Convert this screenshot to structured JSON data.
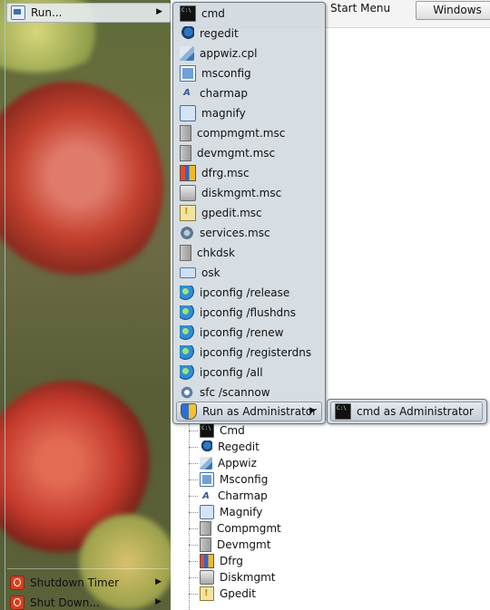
{
  "background_window": {
    "label": "Start Menu",
    "button_label": "Windows",
    "tree": [
      {
        "label": "Cmd",
        "icon": "cmd-icon"
      },
      {
        "label": "Regedit",
        "icon": "regedit-icon"
      },
      {
        "label": "Appwiz",
        "icon": "appwiz-icon"
      },
      {
        "label": "Msconfig",
        "icon": "msconfig-icon"
      },
      {
        "label": "Charmap",
        "icon": "charmap-icon"
      },
      {
        "label": "Magnify",
        "icon": "magnify-icon"
      },
      {
        "label": "Compmgmt",
        "icon": "compmgmt-icon"
      },
      {
        "label": "Devmgmt",
        "icon": "devmgmt-icon"
      },
      {
        "label": "Dfrg",
        "icon": "dfrg-icon"
      },
      {
        "label": "Diskmgmt",
        "icon": "diskmgmt-icon"
      },
      {
        "label": "Gpedit",
        "icon": "gpedit-icon"
      }
    ]
  },
  "left_menu": {
    "run": {
      "label": "Run...",
      "icon": "run-icon"
    },
    "shutdown_timer": {
      "label": "Shutdown Timer",
      "icon": "power-icon"
    },
    "shutdown": {
      "label": "Shut Down...",
      "icon": "power-icon"
    }
  },
  "run_submenu": {
    "items": [
      {
        "label": "cmd",
        "icon": "cmd-icon",
        "cls": "i-cmd"
      },
      {
        "label": "regedit",
        "icon": "regedit-icon",
        "cls": "i-reg"
      },
      {
        "label": "appwiz.cpl",
        "icon": "appwiz-icon",
        "cls": "i-cpl"
      },
      {
        "label": "msconfig",
        "icon": "msconfig-icon",
        "cls": "i-scr"
      },
      {
        "label": "charmap",
        "icon": "charmap-icon",
        "cls": "i-char"
      },
      {
        "label": "magnify",
        "icon": "magnify-icon",
        "cls": "i-mag"
      },
      {
        "label": "compmgmt.msc",
        "icon": "compmgmt-icon",
        "cls": "i-tower"
      },
      {
        "label": "devmgmt.msc",
        "icon": "devmgmt-icon",
        "cls": "i-tower"
      },
      {
        "label": "dfrg.msc",
        "icon": "dfrg-icon",
        "cls": "i-dfrg"
      },
      {
        "label": "diskmgmt.msc",
        "icon": "diskmgmt-icon",
        "cls": "i-disk"
      },
      {
        "label": "gpedit.msc",
        "icon": "gpedit-icon",
        "cls": "i-gp"
      },
      {
        "label": "services.msc",
        "icon": "services-icon",
        "cls": "i-gear"
      },
      {
        "label": "chkdsk",
        "icon": "chkdsk-icon",
        "cls": "i-tower"
      },
      {
        "label": "osk",
        "icon": "keyboard-icon",
        "cls": "i-kb"
      },
      {
        "label": "ipconfig /release",
        "icon": "network-globe-icon",
        "cls": "i-globe"
      },
      {
        "label": "ipconfig /flushdns",
        "icon": "network-globe-icon",
        "cls": "i-globe"
      },
      {
        "label": "ipconfig /renew",
        "icon": "network-globe-icon",
        "cls": "i-globe"
      },
      {
        "label": "ipconfig /registerdns",
        "icon": "network-globe-icon",
        "cls": "i-globe"
      },
      {
        "label": "ipconfig /all",
        "icon": "network-globe-icon",
        "cls": "i-globe"
      },
      {
        "label": "sfc /scannow",
        "icon": "sfc-icon",
        "cls": "i-sfc"
      }
    ],
    "run_as_admin": {
      "label": "Run as Administrator",
      "icon": "uac-shield-icon"
    }
  },
  "admin_submenu": {
    "items": [
      {
        "label": "cmd as Administrator",
        "icon": "cmd-icon"
      }
    ]
  }
}
